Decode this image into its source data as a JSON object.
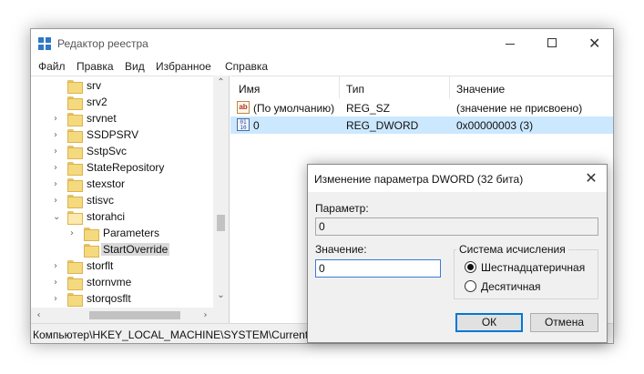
{
  "window": {
    "title": "Редактор реестра",
    "menu": [
      "Файл",
      "Правка",
      "Вид",
      "Избранное",
      "Справка"
    ]
  },
  "tree": {
    "items": [
      {
        "label": "srv",
        "expanded": false,
        "depth": 1
      },
      {
        "label": "srv2",
        "expanded": false,
        "depth": 1
      },
      {
        "label": "srvnet",
        "expanded": false,
        "depth": 1
      },
      {
        "label": "SSDPSRV",
        "expanded": false,
        "depth": 1
      },
      {
        "label": "SstpSvc",
        "expanded": false,
        "depth": 1
      },
      {
        "label": "StateRepository",
        "expanded": false,
        "depth": 1
      },
      {
        "label": "stexstor",
        "expanded": false,
        "depth": 1
      },
      {
        "label": "stisvc",
        "expanded": false,
        "depth": 1
      },
      {
        "label": "storahci",
        "expanded": true,
        "depth": 1
      },
      {
        "label": "Parameters",
        "expanded": false,
        "depth": 2
      },
      {
        "label": "StartOverride",
        "expanded": false,
        "depth": 2,
        "selected": true
      },
      {
        "label": "storflt",
        "expanded": false,
        "depth": 1
      },
      {
        "label": "stornvme",
        "expanded": false,
        "depth": 1
      },
      {
        "label": "storqosflt",
        "expanded": false,
        "depth": 1
      }
    ]
  },
  "list": {
    "headers": {
      "name": "Имя",
      "type": "Тип",
      "value": "Значение"
    },
    "rows": [
      {
        "name": "(По умолчанию)",
        "type": "REG_SZ",
        "value": "(значение не присвоено)",
        "icon": "string-value-icon"
      },
      {
        "name": "0",
        "type": "REG_DWORD",
        "value": "0x00000003 (3)",
        "icon": "binary-value-icon",
        "selected": true
      }
    ]
  },
  "statusbar": {
    "path": "Компьютер\\HKEY_LOCAL_MACHINE\\SYSTEM\\CurrentC"
  },
  "dialog": {
    "title": "Изменение параметра DWORD (32 бита)",
    "param_label": "Параметр:",
    "param_value": "0",
    "value_label": "Значение:",
    "value_value": "0",
    "base_group_label": "Система исчисления",
    "radio_hex": "Шестнадцатеричная",
    "radio_dec": "Десятичная",
    "selected_base": "hex",
    "ok_label": "ОК",
    "cancel_label": "Отмена"
  },
  "colors": {
    "selection": "#cce8ff",
    "accent": "#0078d7"
  }
}
